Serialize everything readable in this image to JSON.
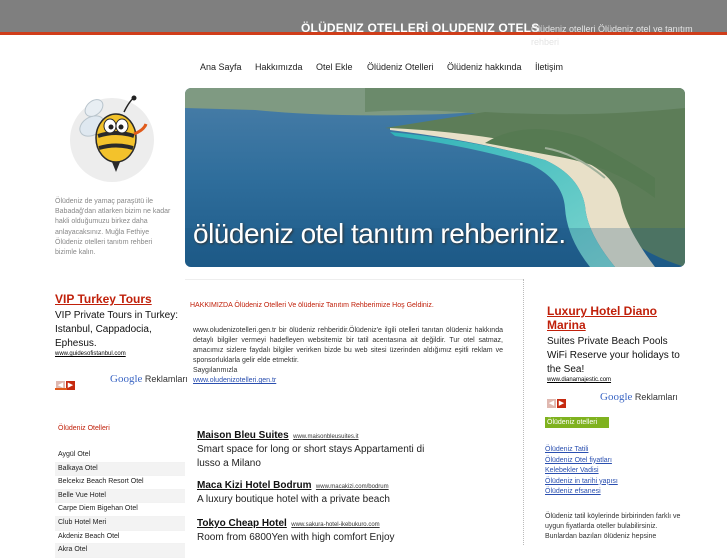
{
  "header": {
    "title": "ÖLÜDENIZ OTELLERİ OLUDENIZ OTELS",
    "description": "Ölüdeniz otelleri Ölüdeniz otel ve tanıtım rehberi"
  },
  "nav": {
    "items": [
      "Ana Sayfa",
      "Hakkımızda",
      "Otel Ekle",
      "Ölüdeniz Otelleri",
      "Ölüdeniz hakkında",
      "İletişim"
    ]
  },
  "intro_text": "Ölüdeniz de yamaç paraşütü ile Babadağ'dan atlarken bizim ne kadar hakli olduğumuzu birkez daha anlayacaksınız. Muğla Fethiye Ölüdeniz otelleri tanıtım rehberi bizimle kalın.",
  "left_ad": {
    "title": "VIP Turkey Tours",
    "body": "VIP Private Tours in Turkey: Istanbul, Cappadocia, Ephesus.",
    "url": "www.guidesofistanbul.com",
    "brand_prefix": "Google",
    "brand_suffix": "Reklamları"
  },
  "hero": {
    "caption": "ölüdeniz otel tanıtım rehberiniz."
  },
  "main": {
    "heading": "HAKKIMIZDA Ölüdeniz Otelleri Ve ölüdeniz Tanıtım Rehberimize Hoş Geldiniz.",
    "paragraph": "www.oludenizotelleri.gen.tr bir ölüdeniz rehberidir.Ölüdeniz'e ilgili otelleri tanıtan ölüdeniz hakkında detaylı bilgiler vermeyi hadefleyen websitemiz bir tatil acentasına ait değildir. Tur otel satmaz, amacımız sizlere faydalı bilgiler verirken bizde bu web sitesi üzerinden aldığımız eşitli reklam ve sponsorluklarla gelir elde etmektir.",
    "greeting": "Saygılarımızla",
    "site_link": "www.oludenizotelleri.gen.tr"
  },
  "hotel_ads": [
    {
      "name": "Maison Bleu Suites",
      "url": "www.maisonbleusuites.it",
      "desc": "Smart space for long or short stays Appartamenti di lusso a Milano"
    },
    {
      "name": "Maca Kizi Hotel Bodrum",
      "url": "www.macakizi.com/bodrum",
      "desc": "A luxury boutique hotel with a private beach"
    },
    {
      "name": "Tokyo Cheap Hotel",
      "url": "www.sakura-hotel-ikebukuro.com",
      "desc": "Room from 6800Yen with high comfort Enjoy"
    }
  ],
  "sidebar": {
    "heading": "Ölüdeniz Otelleri",
    "items": [
      "Aygül Otel",
      "Balkaya Otel",
      "Belcekız Beach Resort Otel",
      "Belle Vue Hotel",
      "Carpe Diem Bigehan Otel",
      "Club Hotel Meri",
      "Akdeniz Beach Otel",
      "Akra Otel"
    ]
  },
  "right_ad": {
    "title": "Luxury Hotel Diano Marina",
    "body": "Suites Private Beach Pools WiFi Reserve your holidays to the Sea!",
    "url": "www.dianamajestic.com",
    "brand_prefix": "Google",
    "brand_suffix": "Reklamları"
  },
  "right_sidebar": {
    "label": "Ölüdeniz otelleri",
    "links": [
      "Ölüdeniz Tatili",
      "Ölüdeniz Otel fiyatları",
      "Kelebekler Vadisi",
      "Ölüdeniz in tarihi yapısı",
      "Ölüdeniz efsanesi"
    ],
    "text": "Ölüdeniz tatil köylerinde birbirinden farklı ve uygun fiyatlarda oteller bulabilirsiniz. Bunlardan bazıları ölüdeniz hepsine"
  },
  "icons": {
    "mascot": "bee-mascot-icon",
    "prev": "chevron-left-icon",
    "next": "chevron-right-icon"
  },
  "colors": {
    "header_bg": "#7f7f7f",
    "accent_red": "#cf3d1a",
    "label_green": "#7fb21f",
    "link_blue": "#2a4fb0"
  }
}
